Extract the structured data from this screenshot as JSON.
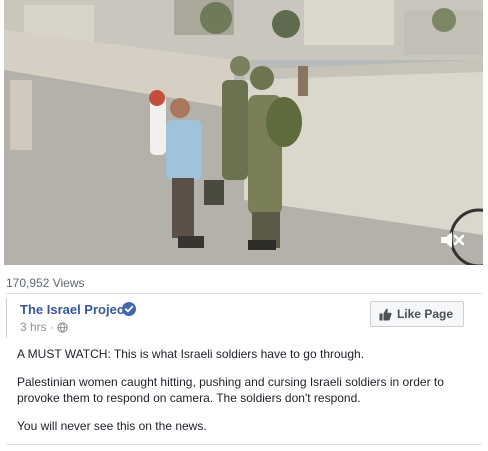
{
  "video": {
    "views": "170,952 Views",
    "mute_icon": "speaker-muted-icon"
  },
  "post": {
    "page_name": "The Israel Project",
    "verified_icon": "verified-badge-icon",
    "time": "3 hrs",
    "separator": "·",
    "privacy_icon": "globe-icon",
    "like_page_label": "Like Page",
    "like_icon": "thumbs-up-icon",
    "paragraphs": [
      "A MUST WATCH: This is what Israeli soldiers have to go through.",
      "Palestinian women caught hitting, pushing and cursing Israeli soldiers in order to provoke them to respond on camera. The soldiers don't respond.",
      "You will never see this on the news."
    ]
  },
  "colors": {
    "link": "#365899",
    "meta": "#90949c",
    "verified": "#4267b2"
  }
}
